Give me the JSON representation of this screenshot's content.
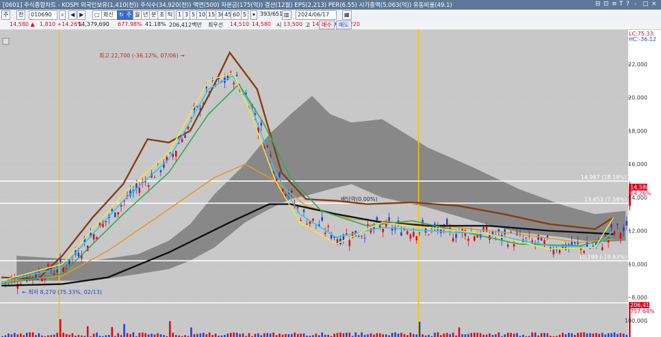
{
  "window": {
    "title": "[0601] 주식종합차트 - KOSPI 외국인보유(1,410(천)) 주식수(34,920(천)) 액면(500) 자본금(175(억)) 결산(12월) EPS(2,213) PER(6.55) 시가총액(5,063(억)) 유동비율(49.1)",
    "controls": [
      "⊟",
      "⊡",
      "≡",
      "T",
      "?",
      "-",
      "▢",
      "×"
    ]
  },
  "toolbar": {
    "mode_label": "주",
    "period_label": "전",
    "code_value": "010690",
    "company_name": "화신",
    "timeframes": [
      "주",
      "월",
      "년",
      "분",
      "초",
      "틱"
    ],
    "intervals": [
      "1",
      "3",
      "5",
      "10",
      "15",
      "30",
      "45",
      "60",
      "5"
    ],
    "count_text": "393/651",
    "date_value": "2024/06/17"
  },
  "pricebar": {
    "price": "14,580 ▲",
    "change": "1,810 +14.26%",
    "trade_value": "14,379,690",
    "volume_ratio": "677.98%",
    "turnover": "41.18%",
    "amount": "206,412백만",
    "best_label": "최우선",
    "best_ask": "14,510",
    "best_bid": "14,580",
    "open_label": "시",
    "open": "13,500",
    "high_label": "고",
    "high": "14,930",
    "low_label": "저",
    "low": "13,220",
    "buy_button": "매수",
    "sell_button": "매도"
  },
  "chart_data": {
    "type": "candlestick",
    "top_right_labels": [
      "LC:75.33",
      "HC:-36.12"
    ],
    "y_ticks": [
      "22,000",
      "20,000",
      "18,000",
      "16,000",
      "14,000",
      "12,000",
      "10,000",
      "8,000"
    ],
    "volume_ticks": [
      "100,000"
    ],
    "ylim": [
      7600,
      24200
    ],
    "current_price_label": "14,580",
    "current_change_label": "14.26%",
    "volume_labels": [
      "206,412",
      "757.64%"
    ],
    "annotations": {
      "high": "최고 22,700 (-36.12%, 07/06)",
      "low": "최저 8,270 (75.33%, 02/13)",
      "dividend": "배당락(0.00%)"
    },
    "hlines": [
      {
        "label": "14,987 (18.18%)",
        "value": 14987
      },
      {
        "label": "13,653 (7.59%)",
        "value": 13653
      },
      {
        "label": "10,199 (-19.63%)",
        "value": 10199
      }
    ],
    "vlines_n": [
      19,
      137
    ],
    "n_bars": 206,
    "series": [
      {
        "name": "",
        "color": "#8b3a0f",
        "pts": [
          [
            0,
            9200
          ],
          [
            12,
            9100
          ],
          [
            20,
            10500
          ],
          [
            30,
            12800
          ],
          [
            40,
            14800
          ],
          [
            48,
            17500
          ],
          [
            55,
            17300
          ],
          [
            62,
            18000
          ],
          [
            70,
            20800
          ],
          [
            75,
            22700
          ],
          [
            84,
            20500
          ],
          [
            92,
            15500
          ],
          [
            100,
            13900
          ],
          [
            110,
            13800
          ],
          [
            120,
            13600
          ],
          [
            135,
            13700
          ],
          [
            150,
            13500
          ],
          [
            165,
            13000
          ],
          [
            180,
            12400
          ],
          [
            195,
            12100
          ],
          [
            201,
            12800
          ]
        ]
      },
      {
        "name": "",
        "color": "#e59a24",
        "pts": [
          [
            0,
            8900
          ],
          [
            20,
            9300
          ],
          [
            35,
            10800
          ],
          [
            55,
            13300
          ],
          [
            70,
            15200
          ],
          [
            80,
            16000
          ],
          [
            90,
            15000
          ],
          [
            100,
            13500
          ],
          [
            115,
            12700
          ],
          [
            130,
            12500
          ],
          [
            150,
            12200
          ],
          [
            170,
            11800
          ],
          [
            190,
            11300
          ],
          [
            201,
            11500
          ]
        ]
      },
      {
        "name": "",
        "color": "#111111",
        "pts": [
          [
            0,
            8700
          ],
          [
            20,
            8800
          ],
          [
            35,
            9200
          ],
          [
            55,
            10700
          ],
          [
            75,
            12500
          ],
          [
            88,
            13600
          ],
          [
            95,
            13600
          ],
          [
            110,
            13000
          ],
          [
            125,
            12500
          ],
          [
            140,
            12300
          ],
          [
            160,
            12300
          ],
          [
            180,
            12000
          ],
          [
            201,
            11800
          ]
        ]
      },
      {
        "name": "",
        "color": "#2ea85a",
        "pts": [
          [
            0,
            8800
          ],
          [
            20,
            9400
          ],
          [
            40,
            13000
          ],
          [
            55,
            15500
          ],
          [
            68,
            19000
          ],
          [
            78,
            20800
          ],
          [
            86,
            18500
          ],
          [
            95,
            15200
          ],
          [
            105,
            13200
          ],
          [
            120,
            12300
          ],
          [
            135,
            12600
          ],
          [
            150,
            12000
          ],
          [
            170,
            11200
          ],
          [
            190,
            11100
          ],
          [
            201,
            11600
          ]
        ]
      },
      {
        "name": "",
        "color": "#35c4e5",
        "pts": [
          [
            0,
            8900
          ],
          [
            20,
            9800
          ],
          [
            40,
            13800
          ],
          [
            55,
            16300
          ],
          [
            68,
            20500
          ],
          [
            76,
            21300
          ],
          [
            82,
            19500
          ],
          [
            90,
            15500
          ],
          [
            98,
            13000
          ],
          [
            110,
            11600
          ],
          [
            125,
            12200
          ],
          [
            140,
            12000
          ],
          [
            160,
            11800
          ],
          [
            180,
            11100
          ],
          [
            195,
            11000
          ],
          [
            201,
            12000
          ]
        ]
      },
      {
        "name": "",
        "color": "#f4e24a",
        "pts": [
          [
            0,
            9000
          ],
          [
            20,
            10000
          ],
          [
            40,
            14200
          ],
          [
            55,
            16700
          ],
          [
            68,
            21000
          ],
          [
            76,
            21500
          ],
          [
            82,
            19000
          ],
          [
            90,
            15000
          ],
          [
            98,
            12500
          ],
          [
            110,
            11200
          ],
          [
            125,
            12500
          ],
          [
            140,
            12200
          ],
          [
            160,
            11800
          ],
          [
            180,
            10900
          ],
          [
            195,
            11000
          ],
          [
            201,
            12800
          ]
        ]
      }
    ]
  }
}
